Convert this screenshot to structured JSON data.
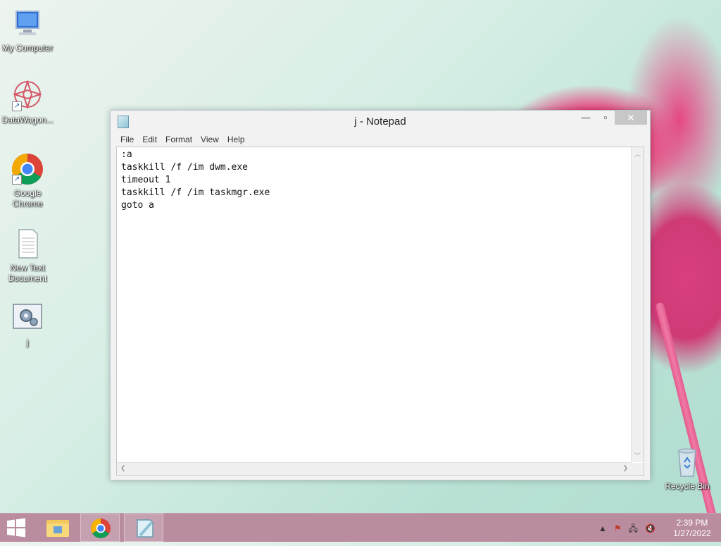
{
  "desktop": {
    "icons": [
      {
        "label": "My Computer"
      },
      {
        "label": "DataWagon..."
      },
      {
        "label": "Google Chrome"
      },
      {
        "label": "New Text Document"
      },
      {
        "label": "j"
      },
      {
        "label": "Recycle Bin"
      }
    ]
  },
  "window": {
    "title": "j - Notepad",
    "menu": [
      "File",
      "Edit",
      "Format",
      "View",
      "Help"
    ],
    "content": ":a\ntaskkill /f /im dwm.exe\ntimeout 1\ntaskkill /f /im taskmgr.exe\ngoto a"
  },
  "taskbar": {
    "time": "2:39 PM",
    "date": "1/27/2022"
  },
  "colors": {
    "taskbar": "#b98ca0",
    "close_button": "#c7c7c7"
  }
}
